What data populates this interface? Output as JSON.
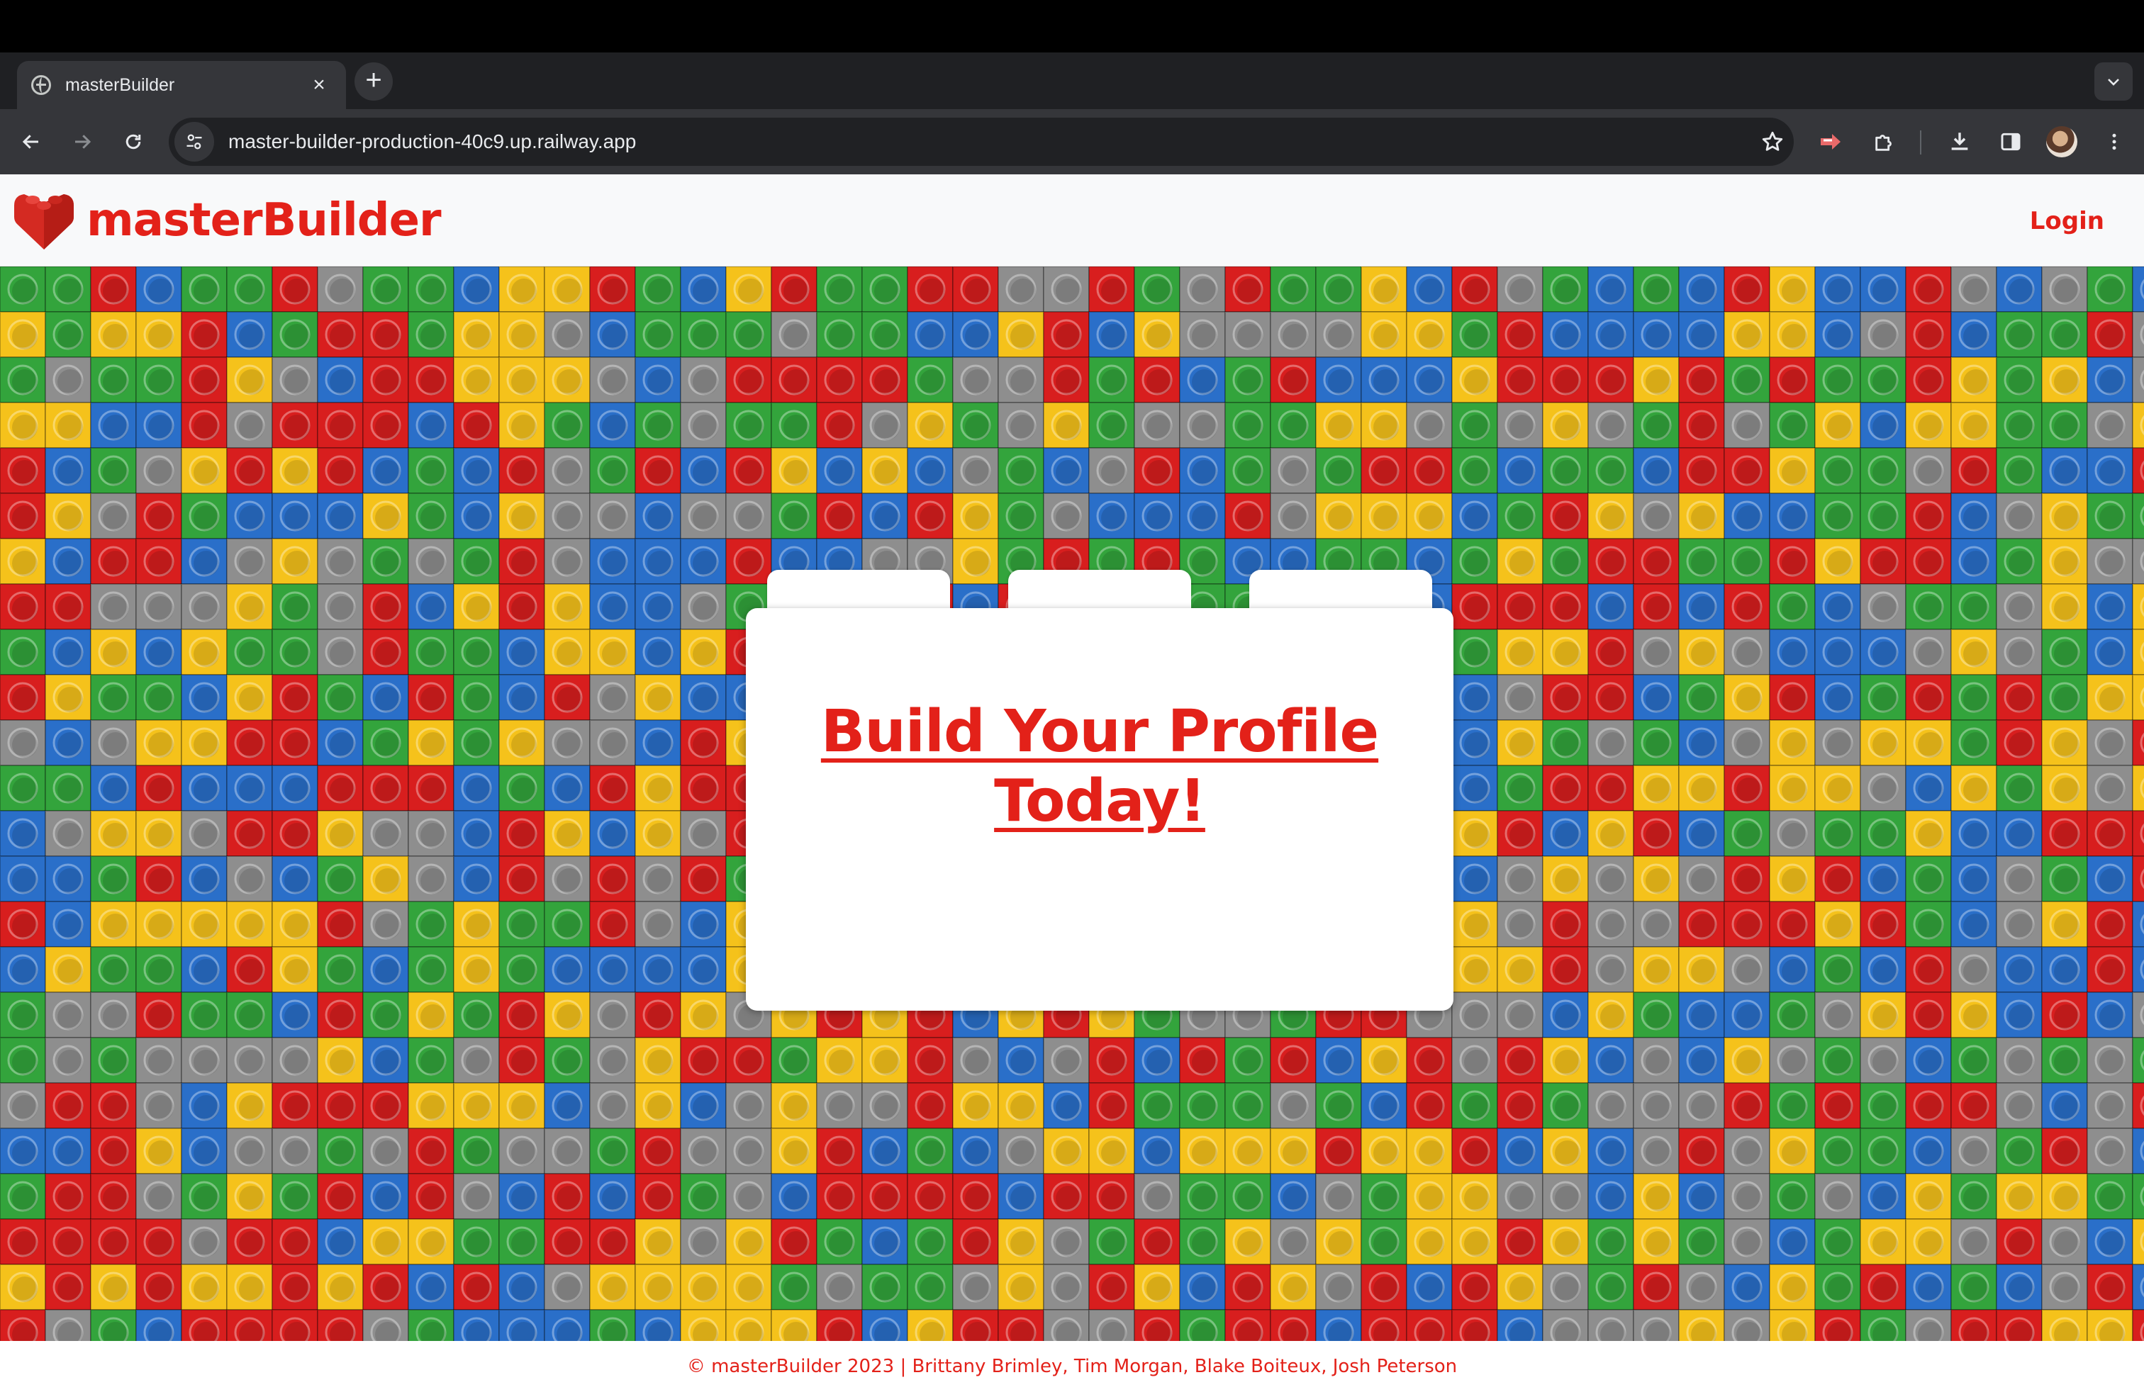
{
  "browser": {
    "tab": {
      "title": "masterBuilder",
      "close_label": "×"
    },
    "new_tab_label": "+",
    "address_bar": {
      "url": "master-builder-production-40c9.up.railway.app"
    }
  },
  "header": {
    "brand_name": "masterBuilder",
    "login_label": "Login"
  },
  "hero": {
    "cta_label": "Build Your Profile Today!",
    "background": "colorful plastic brick pattern"
  },
  "footer": {
    "text": "© masterBuilder 2023 | Brittany Brimley, Tim Morgan, Blake Boiteux, Josh Peterson"
  },
  "colors": {
    "brand_red": "#e32119",
    "brick_colors": [
      "#d81e1e",
      "#2a6fc9",
      "#33a43c",
      "#f5c21b",
      "#8e8e8e"
    ]
  }
}
